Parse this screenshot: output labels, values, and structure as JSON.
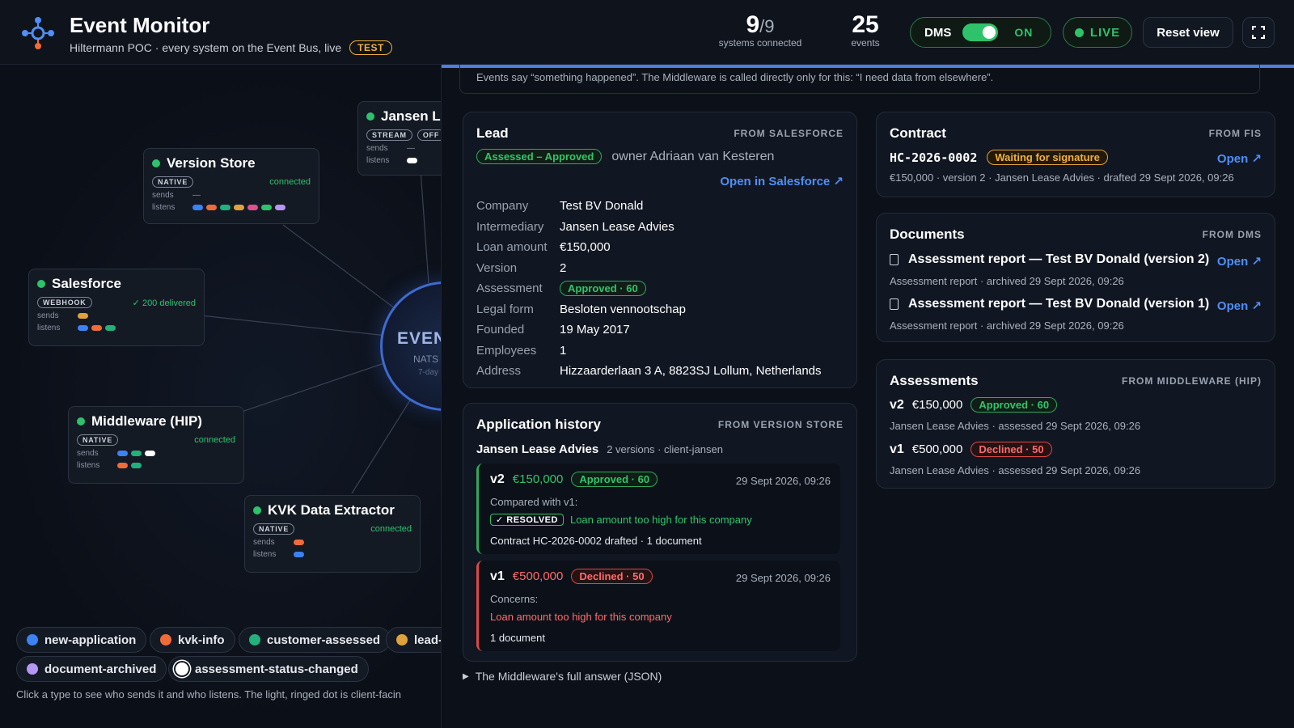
{
  "header": {
    "title": "Event Monitor",
    "subtitle": "Hiltermann POC · every system on the Event Bus, live",
    "env_badge": "TEST",
    "systems_connected": "9",
    "systems_total": "/9",
    "systems_label": "systems connected",
    "events_count": "25",
    "events_label": "events",
    "dms_label": "DMS",
    "dms_state": "ON",
    "live_label": "LIVE",
    "reset_label": "Reset view",
    "fullscreen_icon": "⛶"
  },
  "bus": {
    "title": "EVEN",
    "sub": "NATS J",
    "retention": "7-day"
  },
  "nodes": {
    "version_store": {
      "name": "Version Store",
      "tag": "NATIVE",
      "status": "connected",
      "sends": "—"
    },
    "jansen": {
      "name": "Jansen Le",
      "tag": "STREAM",
      "tag2": "OFF",
      "sends": "—"
    },
    "salesforce": {
      "name": "Salesforce",
      "tag": "WEBHOOK",
      "status": "✓ 200 delivered"
    },
    "middleware": {
      "name": "Middleware (HIP)",
      "tag": "NATIVE",
      "status": "connected"
    },
    "kvk": {
      "name": "KVK Data Extractor",
      "tag": "NATIVE",
      "status": "connected"
    },
    "sends_label": "sends",
    "listens_label": "listens"
  },
  "event_types": [
    {
      "label": "new-application",
      "color": "#3b82f6"
    },
    {
      "label": "kvk-info",
      "color": "#ef6b3a"
    },
    {
      "label": "customer-assessed",
      "color": "#22b07d"
    },
    {
      "label": "lead-",
      "color": "#e0a23a"
    },
    {
      "label": "document-archived",
      "color": "#b596f5"
    },
    {
      "label": "assessment-status-changed",
      "color": "#ffffff"
    }
  ],
  "legend_hint": "Click a type to see who sends it and who listens. The light, ringed dot is client-facin",
  "panel": {
    "note": "Events say “something happened”. The Middleware is called directly only for this: “I need data from elsewhere”.",
    "lead": {
      "title": "Lead",
      "source": "FROM SALESFORCE",
      "status": "Assessed – Approved",
      "owner": "owner Adriaan van Kesteren",
      "open_link": "Open in Salesforce ↗",
      "fields": [
        {
          "k": "Company",
          "v": "Test BV Donald"
        },
        {
          "k": "Intermediary",
          "v": "Jansen Lease Advies"
        },
        {
          "k": "Loan amount",
          "v": "€150,000"
        },
        {
          "k": "Version",
          "v": "2"
        },
        {
          "k": "Assessment",
          "v": "Approved · 60"
        },
        {
          "k": "Legal form",
          "v": "Besloten vennootschap"
        },
        {
          "k": "Founded",
          "v": "19 May 2017"
        },
        {
          "k": "Employees",
          "v": "1"
        },
        {
          "k": "Address",
          "v": "Hizzaarderlaan 3 A, 8823SJ Lollum, Netherlands"
        }
      ]
    },
    "history": {
      "title": "Application history",
      "source": "FROM VERSION STORE",
      "party": "Jansen Lease Advies",
      "party_meta": "2 versions · client-jansen",
      "v2": {
        "ver": "v2",
        "amount": "€150,000",
        "badge": "Approved · 60",
        "date": "29 Sept 2026, 09:26",
        "compared": "Compared with v1:",
        "resolved": "✓ RESOLVED",
        "resolved_text": "Loan amount too high for this company",
        "footer": "Contract HC-2026-0002 drafted · 1 document"
      },
      "v1": {
        "ver": "v1",
        "amount": "€500,000",
        "badge": "Declined · 50",
        "date": "29 Sept 2026, 09:26",
        "concerns": "Concerns:",
        "concern_text": "Loan amount too high for this company",
        "footer": "1 document"
      }
    },
    "json_toggle": "The Middleware's full answer (JSON)",
    "contract": {
      "title": "Contract",
      "source": "FROM FIS",
      "id": "HC-2026-0002",
      "status": "Waiting for signature",
      "open": "Open ↗",
      "meta": "€150,000 · version 2 · Jansen Lease Advies · drafted 29 Sept 2026, 09:26"
    },
    "documents": {
      "title": "Documents",
      "source": "FROM DMS",
      "items": [
        {
          "name": "Assessment report — Test BV Donald (version 2)",
          "meta": "Assessment report · archived 29 Sept 2026, 09:26",
          "open": "Open ↗"
        },
        {
          "name": "Assessment report — Test BV Donald (version 1)",
          "meta": "Assessment report · archived 29 Sept 2026, 09:26",
          "open": "Open ↗"
        }
      ]
    },
    "assessments": {
      "title": "Assessments",
      "source": "FROM MIDDLEWARE (HIP)",
      "items": [
        {
          "ver": "v2",
          "amount": "€150,000",
          "badge": "Approved · 60",
          "meta": "Jansen Lease Advies · assessed 29 Sept 2026, 09:26"
        },
        {
          "ver": "v1",
          "amount": "€500,000",
          "badge": "Declined · 50",
          "meta": "Jansen Lease Advies · assessed 29 Sept 2026, 09:26"
        }
      ]
    }
  }
}
